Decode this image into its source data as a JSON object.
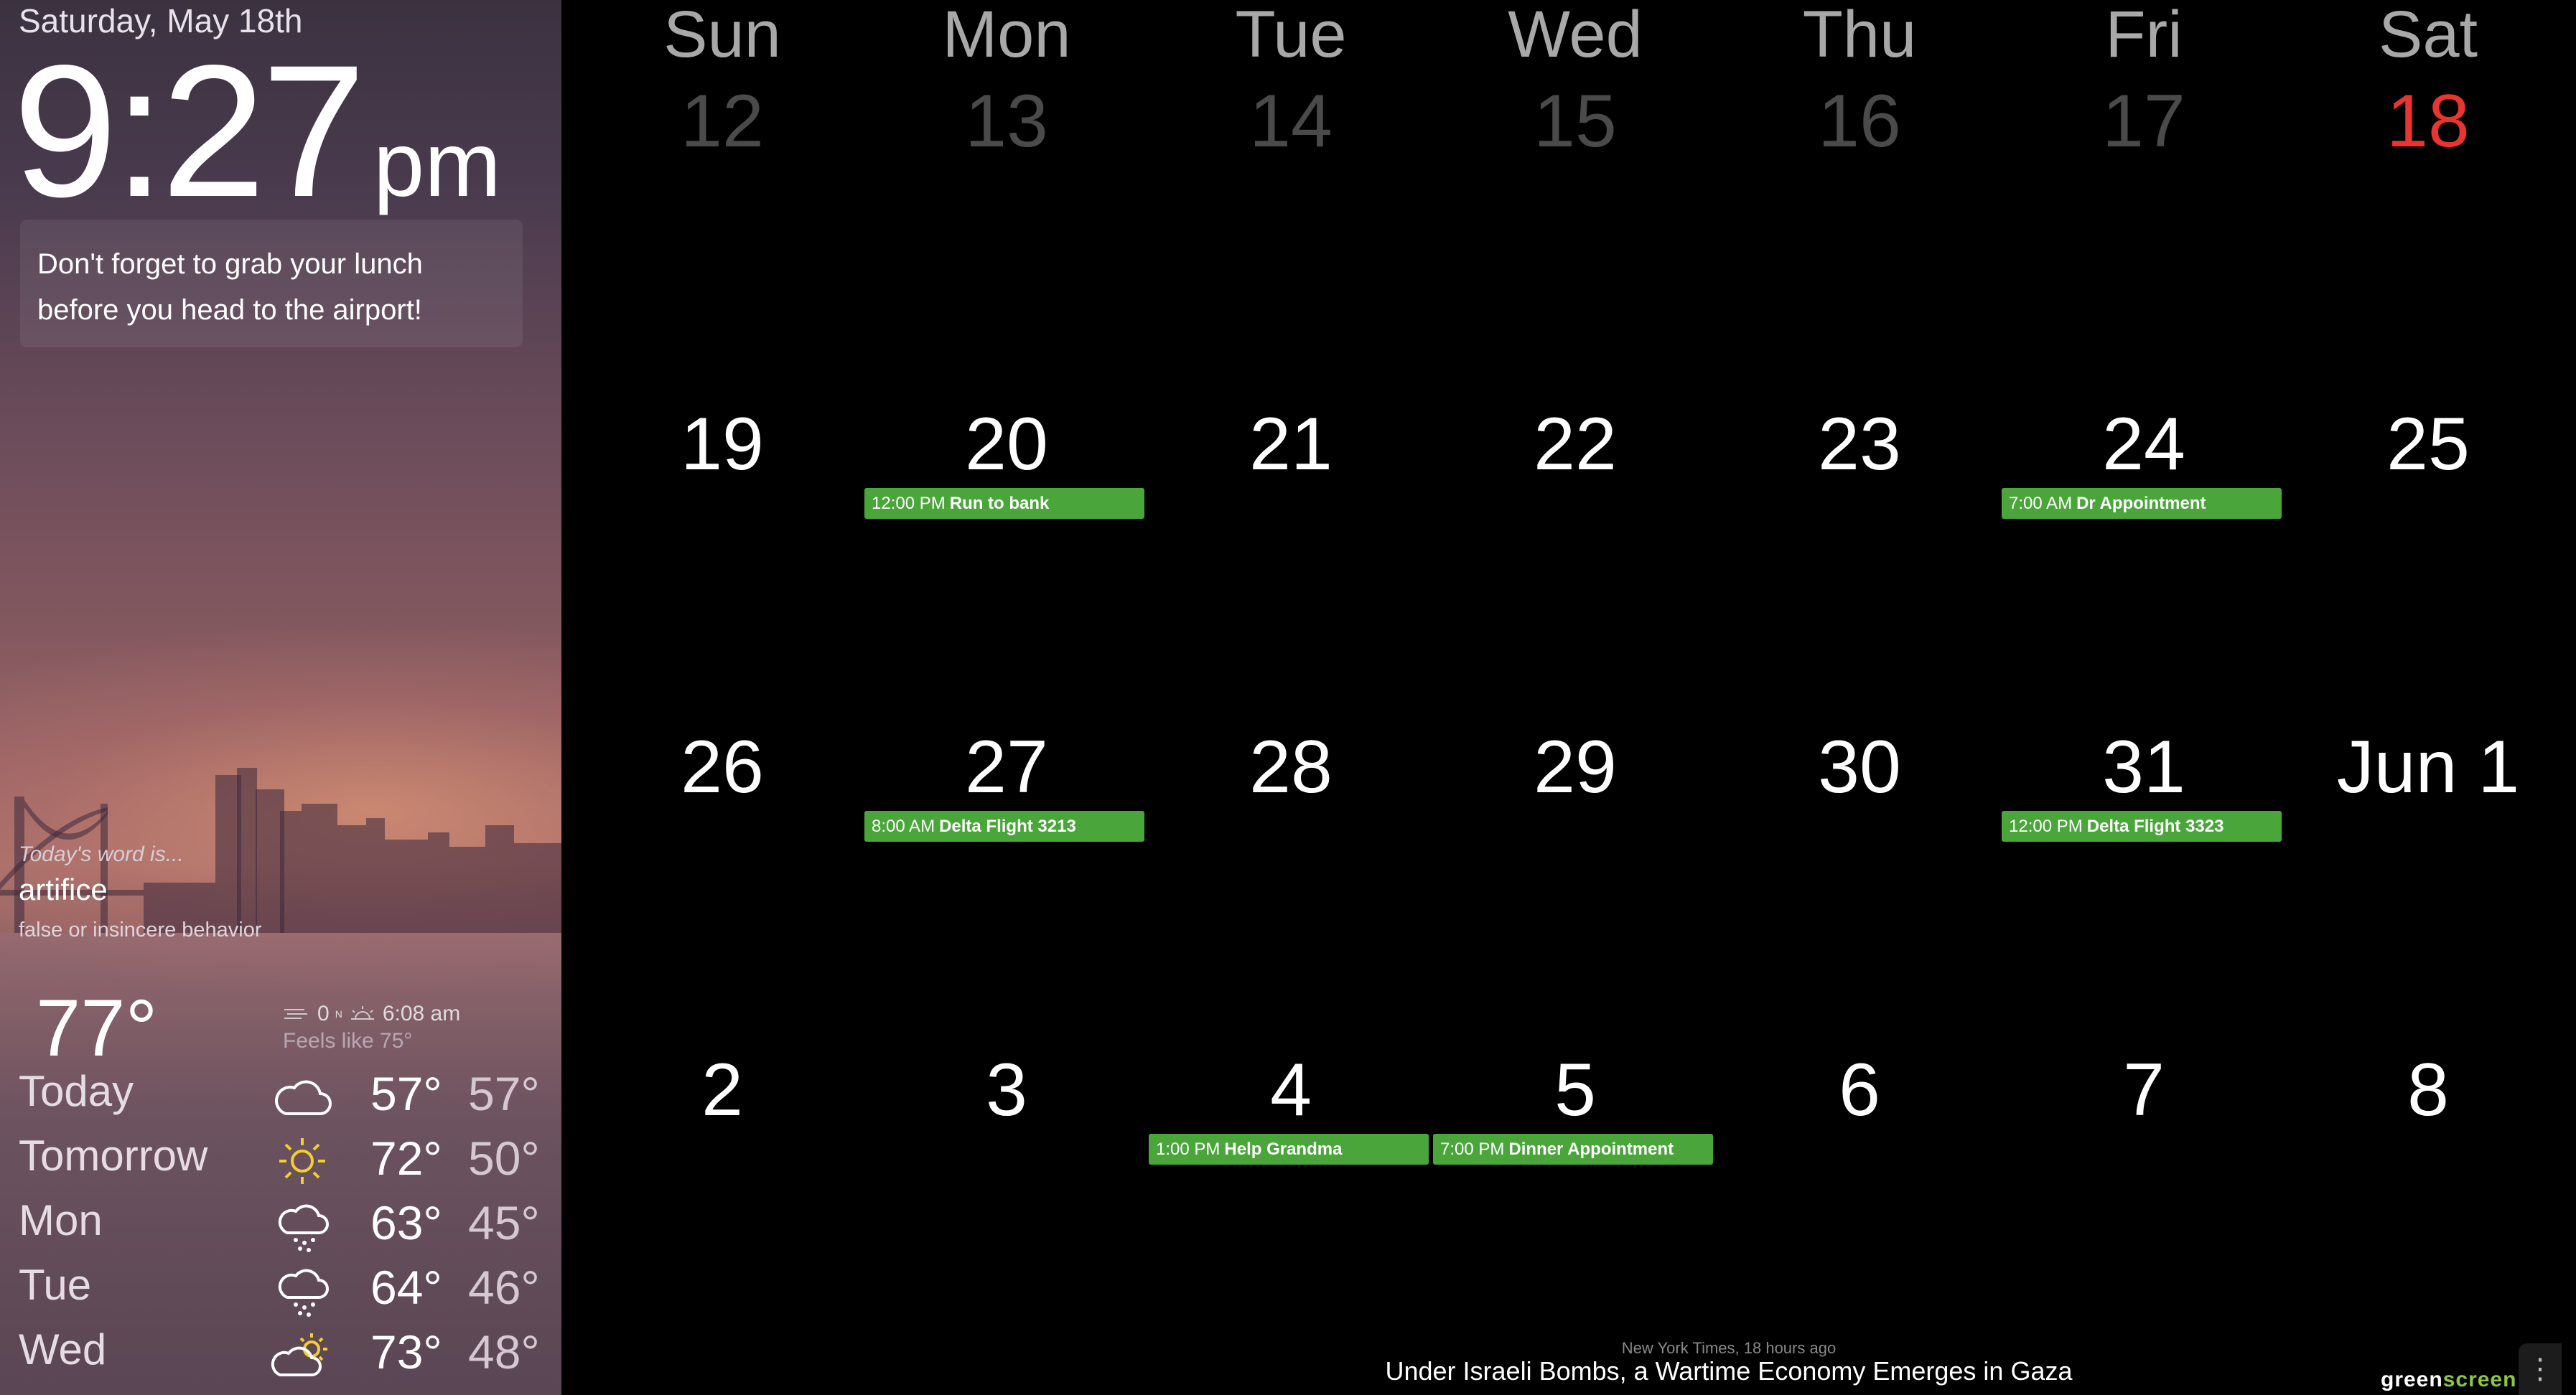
{
  "sidebar": {
    "date": "Saturday, May 18th",
    "time": "9:27",
    "ampm": "pm",
    "note": "Don't forget to grab your lunch before you head to the airport!",
    "word_intro": "Today's word is...",
    "word": "artifice",
    "word_definition": "false or insincere behavior"
  },
  "weather": {
    "current_temp": "77°",
    "wind": "0",
    "wind_unit": "N",
    "sunrise": "6:08 am",
    "feels_like": "Feels like 75°",
    "forecast": [
      {
        "day": "Today",
        "icon": "cloud-icon",
        "hi": "57°",
        "lo": "57°"
      },
      {
        "day": "Tomorrow",
        "icon": "sun-icon",
        "hi": "72°",
        "lo": "50°"
      },
      {
        "day": "Mon",
        "icon": "rain-cloud-icon",
        "hi": "63°",
        "lo": "45°"
      },
      {
        "day": "Tue",
        "icon": "rain-cloud-icon",
        "hi": "64°",
        "lo": "46°"
      },
      {
        "day": "Wed",
        "icon": "partly-cloudy-icon",
        "hi": "73°",
        "lo": "48°"
      }
    ]
  },
  "calendar": {
    "weekdays": [
      "Sun",
      "Mon",
      "Tue",
      "Wed",
      "Thu",
      "Fri",
      "Sat"
    ],
    "weeks": [
      [
        {
          "label": "12",
          "state": "past"
        },
        {
          "label": "13",
          "state": "past"
        },
        {
          "label": "14",
          "state": "past"
        },
        {
          "label": "15",
          "state": "past"
        },
        {
          "label": "16",
          "state": "past"
        },
        {
          "label": "17",
          "state": "past"
        },
        {
          "label": "18",
          "state": "today"
        }
      ],
      [
        {
          "label": "19"
        },
        {
          "label": "20"
        },
        {
          "label": "21"
        },
        {
          "label": "22"
        },
        {
          "label": "23"
        },
        {
          "label": "24"
        },
        {
          "label": "25"
        }
      ],
      [
        {
          "label": "26"
        },
        {
          "label": "27"
        },
        {
          "label": "28"
        },
        {
          "label": "29"
        },
        {
          "label": "30"
        },
        {
          "label": "31"
        },
        {
          "label": "Jun 1"
        }
      ],
      [
        {
          "label": "2"
        },
        {
          "label": "3"
        },
        {
          "label": "4"
        },
        {
          "label": "5"
        },
        {
          "label": "6"
        },
        {
          "label": "7"
        },
        {
          "label": "8"
        }
      ]
    ],
    "events": {
      "w1d1": {
        "time": "12:00 PM",
        "title": "Run to bank"
      },
      "w1d5": {
        "time": "7:00 AM",
        "title": "Dr Appointment"
      },
      "w2d1": {
        "time": "8:00 AM",
        "title": "Delta Flight 3213"
      },
      "w2d5": {
        "time": "12:00 PM",
        "title": "Delta Flight 3323"
      },
      "w3d2": {
        "time": "1:00 PM",
        "title": "Help Grandma"
      },
      "w3d3": {
        "time": "7:00 PM",
        "title": "Dinner Appointment"
      }
    },
    "colors": {
      "event": "#4aa63a",
      "today": "#e8352f",
      "past": "#4a4a4a"
    }
  },
  "news": {
    "source": "New York Times, 18 hours ago",
    "headline": "Under Israeli Bombs, a Wartime Economy Emerges in Gaza"
  },
  "brand": {
    "part1": "green",
    "part2": "screen"
  },
  "menu_button": "⋮"
}
